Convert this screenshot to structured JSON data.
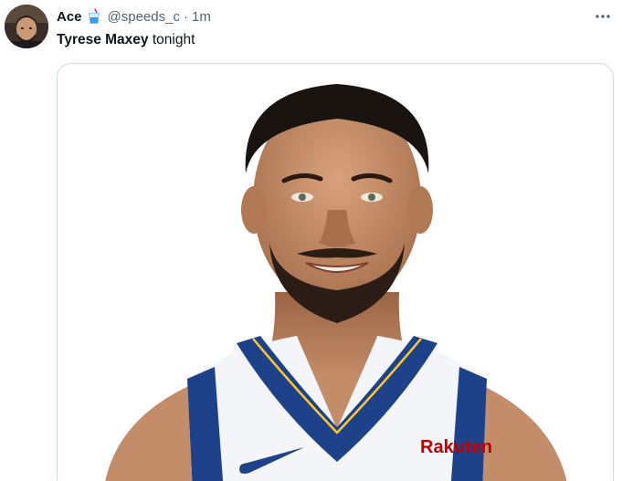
{
  "tweet": {
    "display_name": "Ace",
    "handle": "@speeds_c",
    "separator": "·",
    "time": "1m",
    "text_bold": "Tyrese Maxey",
    "text_rest": " tonight",
    "jersey_sponsor": "Rakuten"
  },
  "icons": {
    "name_emoji": "cup-with-straw-icon",
    "more": "more-horizontal-icon"
  },
  "colors": {
    "jersey_blue": "#1d428a",
    "jersey_gold": "#ffc72c",
    "sponsor_red": "#bf0000",
    "text_primary": "#0f1419",
    "text_secondary": "#536471"
  }
}
